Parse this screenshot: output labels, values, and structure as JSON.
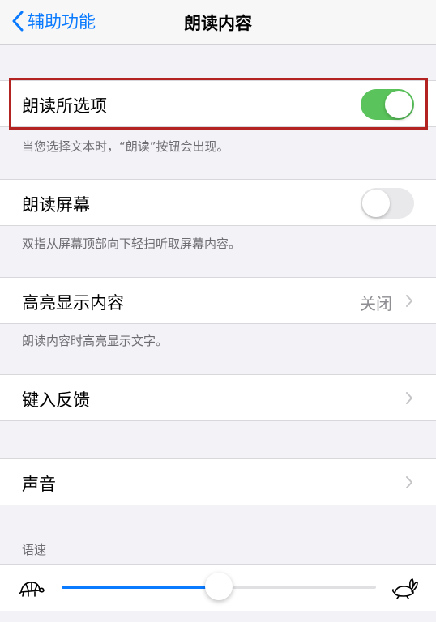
{
  "navbar": {
    "back_label": "辅助功能",
    "title": "朗读内容"
  },
  "speak_selection": {
    "label": "朗读所选项",
    "on": true,
    "footnote": "当您选择文本时，“朗读”按钮会出现。"
  },
  "speak_screen": {
    "label": "朗读屏幕",
    "on": false,
    "footnote": "双指从屏幕顶部向下轻扫听取屏幕内容。"
  },
  "highlight_content": {
    "label": "高亮显示内容",
    "value": "关闭",
    "footnote": "朗读内容时高亮显示文字。"
  },
  "typing_feedback": {
    "label": "键入反馈"
  },
  "voices": {
    "label": "声音"
  },
  "speaking_rate": {
    "header": "语速",
    "value": 0.5
  },
  "colors": {
    "accent": "#0a7aff",
    "toggle_on": "#5ac35b",
    "highlight_border": "#b22322"
  }
}
